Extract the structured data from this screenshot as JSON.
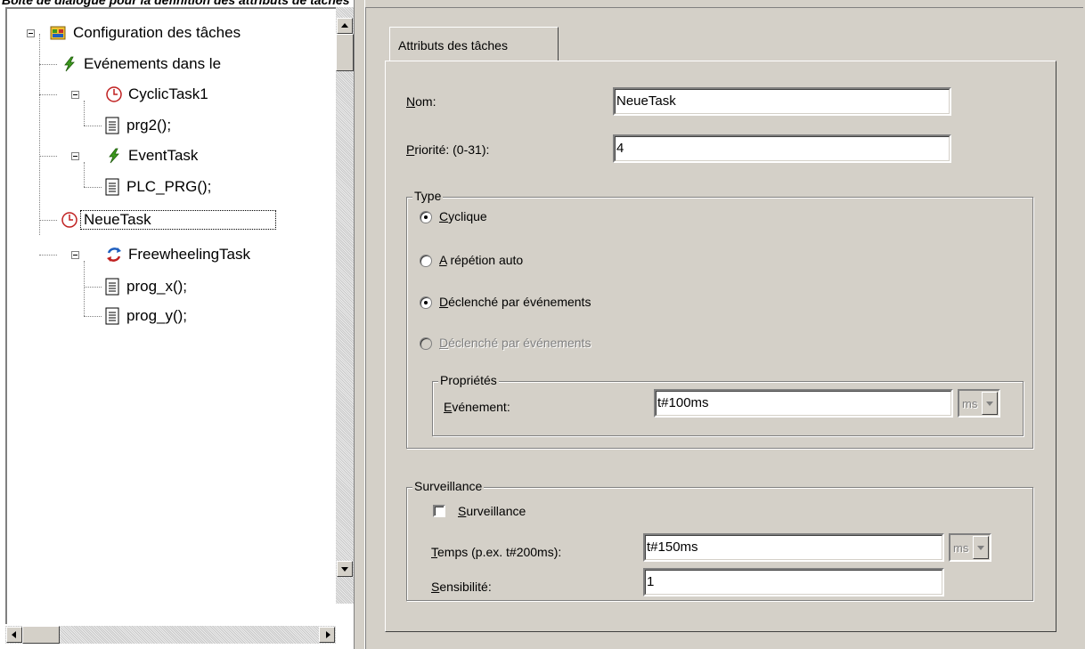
{
  "caption": "Boîte de dialogue pour la définition des attributs de tâches",
  "tree": {
    "items": [
      {
        "label": "Configuration des tâches",
        "icon": "task-config-icon"
      },
      {
        "label": "Evénements dans le",
        "icon": "lightning-icon"
      },
      {
        "label": "CyclicTask1",
        "icon": "clock-icon"
      },
      {
        "label": "prg2();",
        "icon": "document-icon"
      },
      {
        "label": "EventTask",
        "icon": "lightning-icon"
      },
      {
        "label": "PLC_PRG();",
        "icon": "document-icon"
      },
      {
        "label": "NeueTask",
        "icon": "clock-icon",
        "selected": true
      },
      {
        "label": "FreewheelingTask",
        "icon": "freewheel-icon"
      },
      {
        "label": "prog_x();",
        "icon": "document-icon"
      },
      {
        "label": "prog_y();",
        "icon": "document-icon"
      }
    ]
  },
  "dialog": {
    "tab_label": "Attributs des tâches",
    "name_label": {
      "u": "N",
      "rest": "om:"
    },
    "name_value": "NeueTask",
    "priority_label": {
      "u": "P",
      "rest": "riorité: (0-31):"
    },
    "priority_value": "4",
    "type_group": {
      "title": "Type",
      "options": [
        {
          "u": "C",
          "rest": "yclique",
          "checked": true,
          "disabled": false
        },
        {
          "u": "A",
          "rest": " répétion auto",
          "checked": false,
          "disabled": false
        },
        {
          "u": "D",
          "rest": "éclenché par événements",
          "checked": true,
          "disabled": false
        },
        {
          "u": "D",
          "rest": "éclenché par événements",
          "checked": false,
          "disabled": true
        }
      ],
      "properties": {
        "title": "Propriétés",
        "event_label": {
          "u": "E",
          "rest": "vénement:"
        },
        "event_value": "t#100ms",
        "unit": "ms"
      }
    },
    "monitoring_group": {
      "title": "Surveillance",
      "checkbox_label": {
        "u": "S",
        "rest": "urveillance"
      },
      "checked": false,
      "time_label": {
        "u": "T",
        "rest": "emps (p.ex. t#200ms):"
      },
      "time_value": "t#150ms",
      "unit": "ms",
      "sensitivity_label": {
        "u": "S",
        "rest": "ensibilité:"
      },
      "sensitivity_value": "1"
    }
  },
  "colors": {
    "face": "#d4d0c8",
    "shadow": "#808080",
    "icon_green": "#3c9a1e",
    "icon_blue": "#1f5fbf"
  }
}
